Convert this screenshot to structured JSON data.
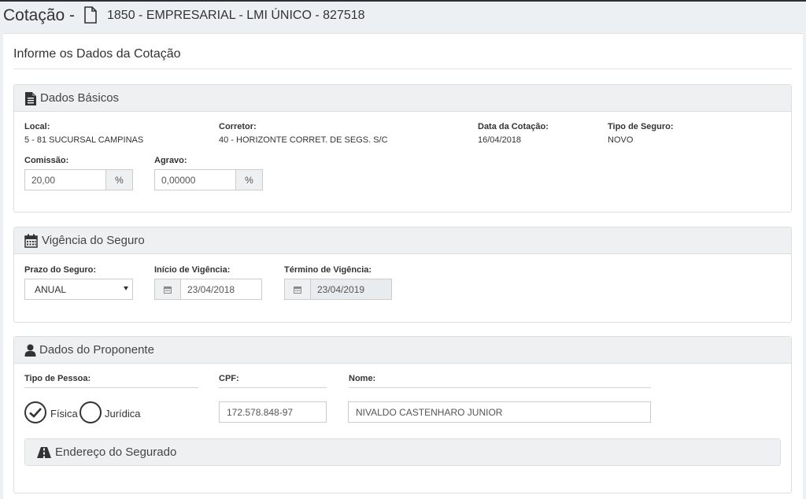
{
  "header": {
    "title": "Cotação -",
    "subtitle": "1850 - EMPRESARIAL - LMI ÚNICO - 827518",
    "icon": "document-icon"
  },
  "card": {
    "title": "Informe os Dados da Cotação"
  },
  "basic": {
    "title": "Dados Básicos",
    "icon": "file-text-icon",
    "local_label": "Local:",
    "local_value": "5 - 81 SUCURSAL CAMPINAS",
    "corretor_label": "Corretor:",
    "corretor_value": "40 - HORIZONTE CORRET. DE SEGS. S/C",
    "data_label": "Data da Cotação:",
    "data_value": "16/04/2018",
    "tipo_label": "Tipo de Seguro:",
    "tipo_value": "NOVO",
    "comissao_label": "Comissão:",
    "comissao_value": "20,00",
    "comissao_addon": "%",
    "agravo_label": "Agravo:",
    "agravo_value": "0,00000",
    "agravo_addon": "%"
  },
  "vigencia": {
    "title": "Vigência do Seguro",
    "icon": "calendar-icon",
    "prazo_label": "Prazo do Seguro:",
    "prazo_value": "ANUAL",
    "inicio_label": "Início de Vigência:",
    "inicio_value": "23/04/2018",
    "termino_label": "Término de Vigência:",
    "termino_value": "23/04/2019"
  },
  "proponente": {
    "title": "Dados do Proponente",
    "icon": "user-icon",
    "tipo_label": "Tipo de Pessoa:",
    "fisica_label": "Física",
    "juridica_label": "Jurídica",
    "selected": "Física",
    "cpf_label": "CPF:",
    "cpf_value": "172.578.848-97",
    "nome_label": "Nome:",
    "nome_value": "NIVALDO CASTENHARO JUNIOR"
  },
  "endereco": {
    "title": "Endereço do Segurado",
    "icon": "road-icon"
  }
}
